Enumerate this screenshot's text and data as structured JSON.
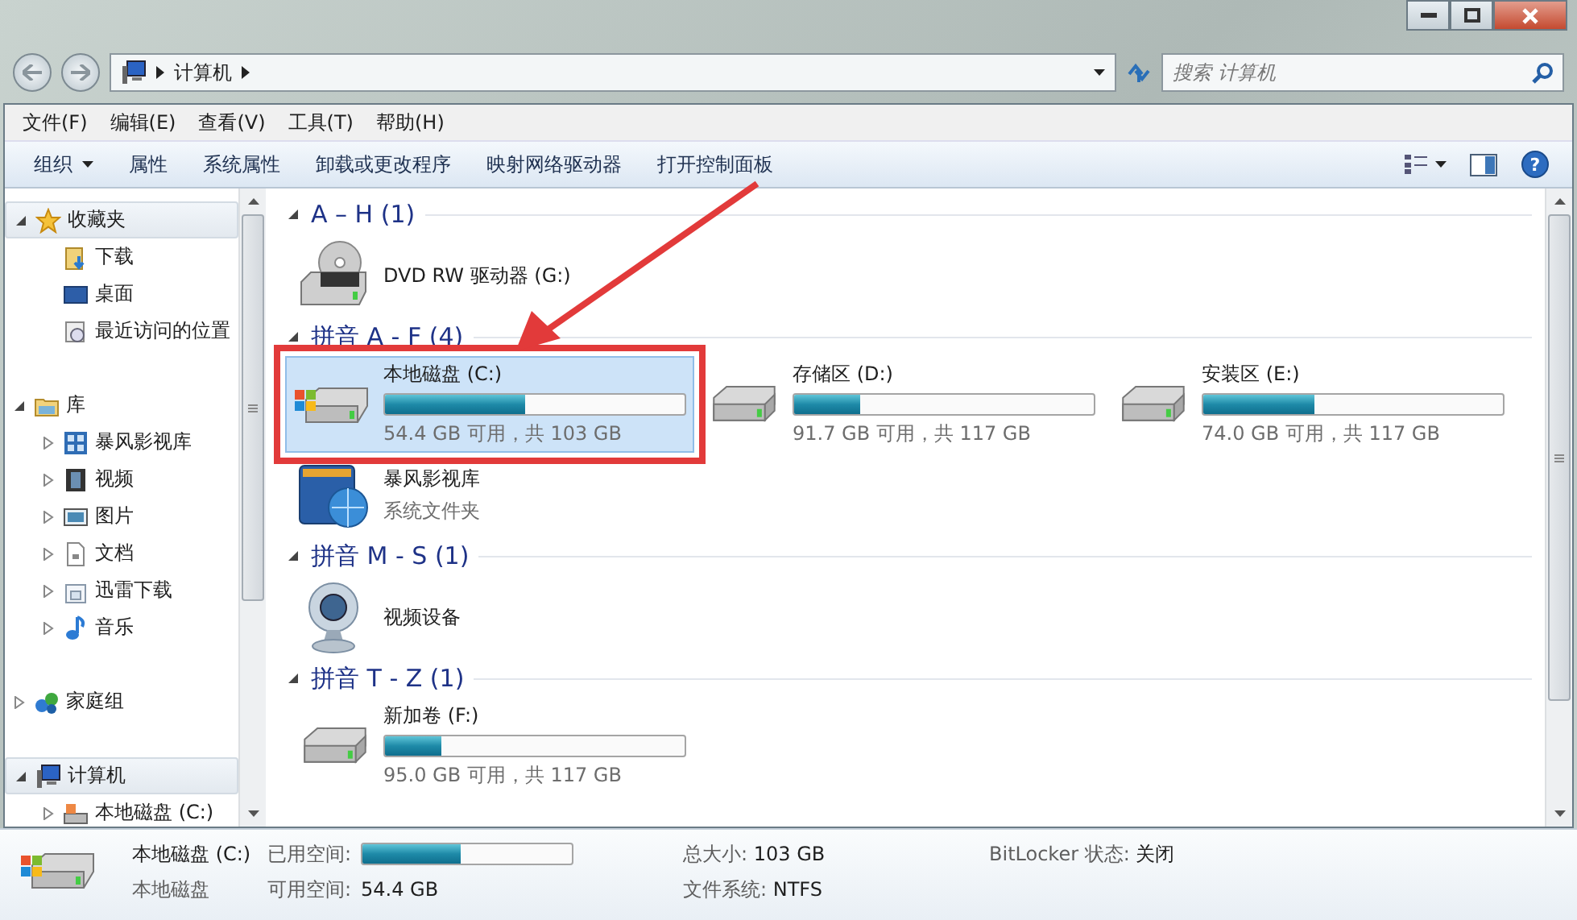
{
  "address_bar": {
    "path": [
      "计算机"
    ],
    "search_placeholder": "搜索 计算机"
  },
  "menu_bar": [
    "文件(F)",
    "编辑(E)",
    "查看(V)",
    "工具(T)",
    "帮助(H)"
  ],
  "command_bar": [
    {
      "label": "组织",
      "dropdown": true
    },
    {
      "label": "属性",
      "dropdown": false
    },
    {
      "label": "系统属性",
      "dropdown": false
    },
    {
      "label": "卸载或更改程序",
      "dropdown": false
    },
    {
      "label": "映射网络驱动器",
      "dropdown": false
    },
    {
      "label": "打开控制面板",
      "dropdown": false
    }
  ],
  "navigation": [
    {
      "label": "收藏夹",
      "expanded": true,
      "highlighted": true,
      "children": [
        {
          "label": "下载"
        },
        {
          "label": "桌面"
        },
        {
          "label": "最近访问的位置"
        }
      ]
    },
    {
      "label": "库",
      "expanded": true,
      "highlighted": false,
      "children": [
        {
          "label": "暴风影视库",
          "expanded": false
        },
        {
          "label": "视频",
          "expanded": false
        },
        {
          "label": "图片",
          "expanded": false
        },
        {
          "label": "文档",
          "expanded": false
        },
        {
          "label": "迅雷下载",
          "expanded": false
        },
        {
          "label": "音乐",
          "expanded": false
        }
      ]
    },
    {
      "label": "家庭组",
      "expanded": false,
      "highlighted": false
    },
    {
      "label": "计算机",
      "expanded": true,
      "highlighted": true,
      "children": [
        {
          "label": "本地磁盘 (C:)",
          "expanded": false
        }
      ]
    }
  ],
  "groups": [
    {
      "title": "A – H (1)",
      "expanded": true,
      "items": [
        {
          "kind": "optical",
          "name": "DVD RW 驱动器 (G:)",
          "selected": false
        }
      ]
    },
    {
      "title": "拼音 A - F (4)",
      "expanded": true,
      "items": [
        {
          "kind": "system_disk",
          "name": "本地磁盘 (C:)",
          "level": 0.47,
          "info": "54.4 GB 可用，共 103 GB",
          "selected": true
        },
        {
          "kind": "disk",
          "name": "存储区 (D:)",
          "level": 0.22,
          "info": "91.7 GB 可用，共 117 GB",
          "selected": false
        },
        {
          "kind": "disk",
          "name": "安装区 (E:)",
          "level": 0.37,
          "info": "74.0 GB 可用，共 117 GB",
          "selected": false
        },
        {
          "kind": "library",
          "name": "暴风影视库",
          "info": "系统文件夹",
          "selected": false
        }
      ]
    },
    {
      "title": "拼音 M - S (1)",
      "expanded": true,
      "items": [
        {
          "kind": "device",
          "name": "视频设备",
          "selected": false
        }
      ]
    },
    {
      "title": "拼音 T - Z (1)",
      "expanded": true,
      "items": [
        {
          "kind": "disk",
          "name": "新加卷 (F:)",
          "level": 0.19,
          "info": "95.0 GB 可用，共 117 GB",
          "selected": false
        }
      ]
    }
  ],
  "help_button": "?",
  "details": {
    "name": "本地磁盘 (C:)",
    "type": "本地磁盘",
    "used_space": {
      "label": "已用空间:",
      "level": 0.47
    },
    "free_label": "可用空间:",
    "free": "54.4 GB",
    "total_label": "总大小:",
    "total": "103 GB",
    "fs_label": "文件系统:",
    "fs": "NTFS",
    "bitlocker_label": "BitLocker 状态:",
    "bitlocker": "关闭"
  }
}
